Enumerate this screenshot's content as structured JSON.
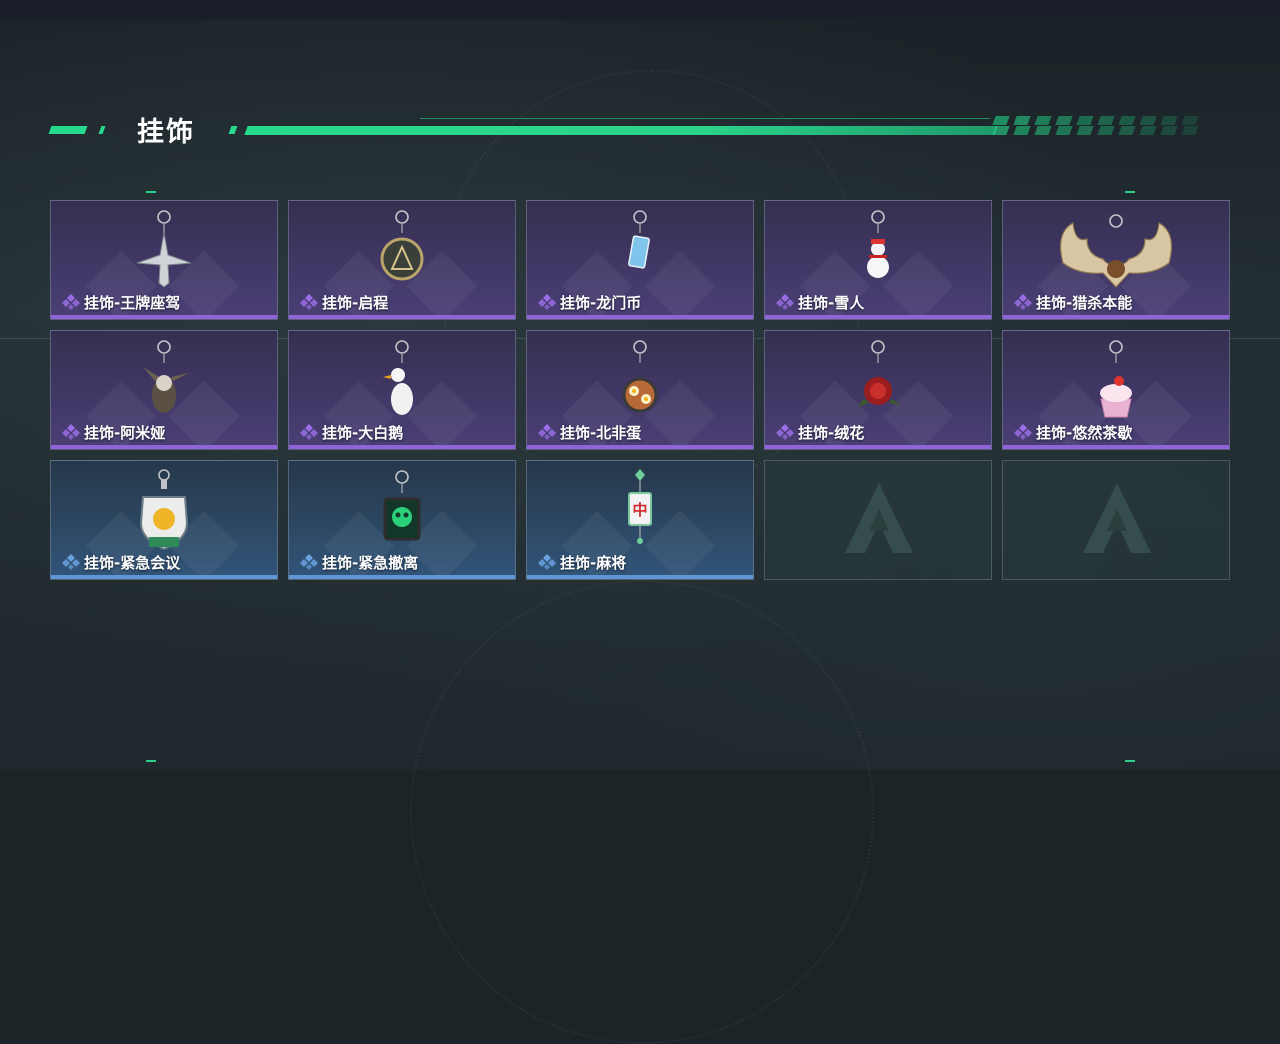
{
  "header": {
    "title": "挂饰"
  },
  "items": [
    {
      "name": "挂饰-王牌座驾",
      "icon": "fighter-jet-charm-icon",
      "rarity": "purple"
    },
    {
      "name": "挂饰-启程",
      "icon": "medallion-charm-icon",
      "rarity": "purple"
    },
    {
      "name": "挂饰-龙门币",
      "icon": "card-charm-icon",
      "rarity": "purple"
    },
    {
      "name": "挂饰-雪人",
      "icon": "snowman-charm-icon",
      "rarity": "purple"
    },
    {
      "name": "挂饰-猎杀本能",
      "icon": "moose-antler-charm-icon",
      "rarity": "purple"
    },
    {
      "name": "挂饰-阿米娅",
      "icon": "bunny-charm-icon",
      "rarity": "purple"
    },
    {
      "name": "挂饰-大白鹅",
      "icon": "goose-charm-icon",
      "rarity": "purple"
    },
    {
      "name": "挂饰-北非蛋",
      "icon": "shakshuka-charm-icon",
      "rarity": "purple"
    },
    {
      "name": "挂饰-绒花",
      "icon": "red-flower-charm-icon",
      "rarity": "purple"
    },
    {
      "name": "挂饰-悠然茶歇",
      "icon": "cupcake-charm-icon",
      "rarity": "purple"
    },
    {
      "name": "挂饰-紧急会议",
      "icon": "crest-charm-icon",
      "rarity": "blue"
    },
    {
      "name": "挂饰-紧急撤离",
      "icon": "green-skull-charm-icon",
      "rarity": "blue"
    },
    {
      "name": "挂饰-麻将",
      "icon": "mahjong-tile-charm-icon",
      "rarity": "blue"
    }
  ],
  "empty_slots": 2,
  "colors": {
    "accent_green": "#27d98c",
    "rarity_purple": "#8e64d8",
    "rarity_blue": "#5f96d6"
  }
}
